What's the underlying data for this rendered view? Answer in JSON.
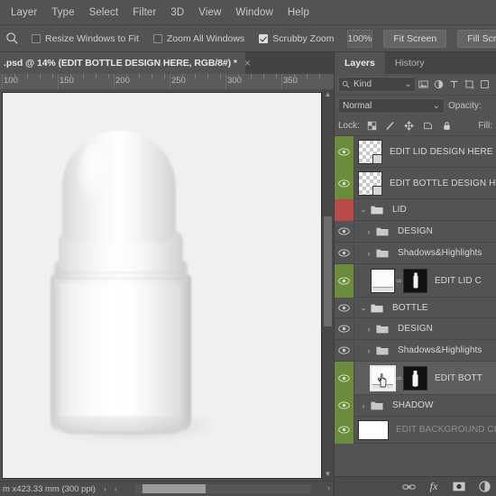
{
  "app": {
    "name": "Adobe Photoshop"
  },
  "menubar": {
    "items": [
      {
        "label": "Layer"
      },
      {
        "label": "Type"
      },
      {
        "label": "Select"
      },
      {
        "label": "Filter"
      },
      {
        "label": "3D"
      },
      {
        "label": "View"
      },
      {
        "label": "Window"
      },
      {
        "label": "Help"
      }
    ]
  },
  "options_bar": {
    "tool_icon": "zoom-tool-icon",
    "checkboxes": [
      {
        "label": "Resize Windows to Fit",
        "checked": false
      },
      {
        "label": "Zoom All Windows",
        "checked": false
      },
      {
        "label": "Scrubby Zoom",
        "checked": true
      }
    ],
    "zoom_value": "100%",
    "buttons": [
      {
        "label": "Fit Screen"
      },
      {
        "label": "Fill Screen"
      }
    ]
  },
  "document": {
    "tab_title": ".psd @ 14% (EDIT BOTTLE DESIGN HERE, RGB/8#) *",
    "close_label": "×",
    "ruler": {
      "unit_labels": [
        "100",
        "150",
        "200",
        "250",
        "300",
        "350"
      ]
    }
  },
  "status_bar": {
    "text": "m x423.33 mm (300 ppi)",
    "chevron": "›",
    "left_arrow": "‹",
    "right_arrow": "›"
  },
  "panel": {
    "tabs": [
      {
        "label": "Layers",
        "active": true
      },
      {
        "label": "History",
        "active": false
      }
    ],
    "filter": {
      "search_icon": "search-icon",
      "kind_label": "Kind",
      "chevron": "⌄",
      "icons": [
        {
          "name": "pixel-filter-icon"
        },
        {
          "name": "adjustment-filter-icon"
        },
        {
          "name": "type-filter-icon"
        },
        {
          "name": "shape-filter-icon"
        },
        {
          "name": "smart-object-filter-icon"
        }
      ]
    },
    "blend": {
      "mode": "Normal",
      "chevron": "⌄",
      "opacity_label": "Opacity:"
    },
    "lock": {
      "label": "Lock:",
      "fill_label": "Fill:",
      "icons": [
        {
          "name": "lock-transparent-pixels-icon"
        },
        {
          "name": "lock-image-pixels-icon"
        },
        {
          "name": "lock-position-icon"
        },
        {
          "name": "lock-artboard-nesting-icon"
        },
        {
          "name": "lock-all-icon"
        }
      ]
    },
    "layers": [
      {
        "name": "EDIT LID DESIGN HERE",
        "type": "smart-object",
        "visible": true,
        "eye_state": "green",
        "selected": false,
        "thumb": "checker",
        "indent": 0,
        "has_disclosure": false
      },
      {
        "name": "EDIT BOTTLE DESIGN HE",
        "type": "smart-object",
        "visible": true,
        "eye_state": "green",
        "selected": false,
        "thumb": "checker",
        "indent": 0,
        "has_disclosure": false
      },
      {
        "name": "LID",
        "type": "group",
        "visible": false,
        "eye_state": "red",
        "selected": false,
        "thumb": "none",
        "indent": 0,
        "has_disclosure": true,
        "expanded": true
      },
      {
        "name": "DESIGN",
        "type": "group",
        "visible": true,
        "eye_state": "normal",
        "selected": false,
        "thumb": "none",
        "indent": 1,
        "has_disclosure": true,
        "expanded": false
      },
      {
        "name": "Shadows&Highlights",
        "type": "group",
        "visible": true,
        "eye_state": "normal",
        "selected": false,
        "thumb": "none",
        "indent": 1,
        "has_disclosure": true,
        "expanded": false
      },
      {
        "name": "EDIT LID C",
        "type": "smart-object-masked",
        "visible": true,
        "eye_state": "green",
        "selected": false,
        "thumb": "white",
        "mask": "lid-mask",
        "indent": 1,
        "has_disclosure": false
      },
      {
        "name": "BOTTLE",
        "type": "group",
        "visible": true,
        "eye_state": "normal",
        "selected": false,
        "thumb": "none",
        "indent": 0,
        "has_disclosure": true,
        "expanded": true
      },
      {
        "name": "DESIGN",
        "type": "group",
        "visible": true,
        "eye_state": "normal",
        "selected": false,
        "thumb": "none",
        "indent": 1,
        "has_disclosure": true,
        "expanded": false
      },
      {
        "name": "Shadows&Highlights",
        "type": "group",
        "visible": true,
        "eye_state": "normal",
        "selected": false,
        "thumb": "none",
        "indent": 1,
        "has_disclosure": true,
        "expanded": false
      },
      {
        "name": "EDIT BOTT",
        "type": "smart-object-masked",
        "visible": true,
        "eye_state": "green",
        "selected": true,
        "thumb": "white",
        "mask": "bottle-mask",
        "cursor": "hand-cursor-icon",
        "indent": 1,
        "has_disclosure": false
      },
      {
        "name": "SHADOW",
        "type": "group",
        "visible": true,
        "eye_state": "green",
        "selected": false,
        "thumb": "none",
        "indent": 0,
        "has_disclosure": true,
        "expanded": false
      },
      {
        "name": "EDIT BACKGROUND COL",
        "type": "solid-color",
        "visible": true,
        "eye_state": "green",
        "selected": false,
        "thumb": "white",
        "indent": 0,
        "has_disclosure": false
      }
    ],
    "footer_buttons": [
      {
        "name": "link-layers-icon",
        "label": "∞"
      },
      {
        "name": "layer-style-fx-icon",
        "label": "fx"
      },
      {
        "name": "add-layer-mask-icon",
        "label": "▣"
      },
      {
        "name": "new-adjustment-layer-icon",
        "label": "◑"
      }
    ]
  },
  "colors": {
    "chrome": "#535353",
    "panel_dark": "#444444",
    "eye_green": "#6b8b3d",
    "eye_red": "#b84a4a",
    "text": "#d8d8d8",
    "canvas": "#f0f0f0"
  }
}
